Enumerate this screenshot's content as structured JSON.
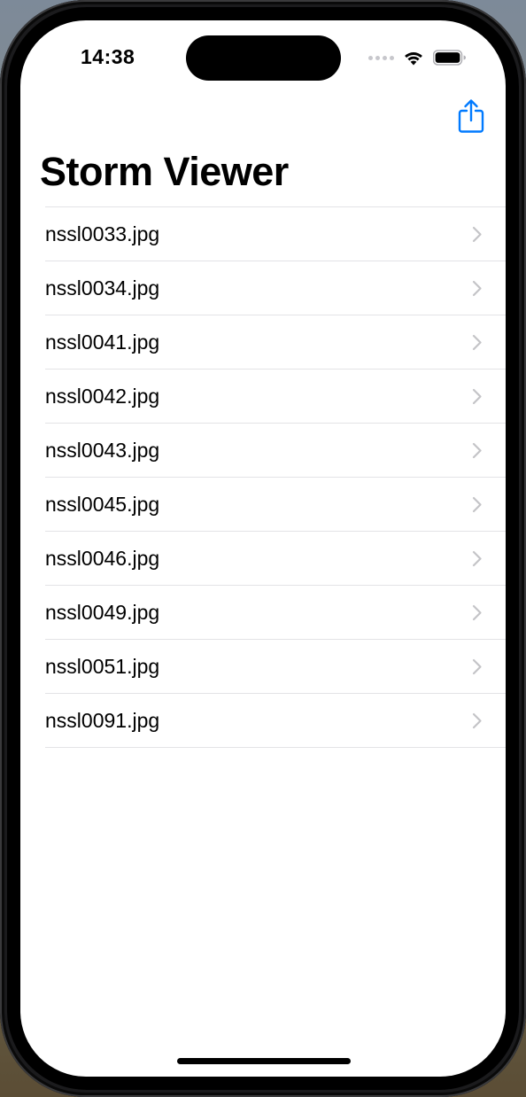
{
  "status_bar": {
    "time": "14:38",
    "wifi_icon": "wifi-icon",
    "battery_icon": "battery-icon"
  },
  "nav_bar": {
    "title": "Storm Viewer",
    "share_icon": "share-icon",
    "accent_color": "#007AFF"
  },
  "files": [
    {
      "label": "nssl0033.jpg"
    },
    {
      "label": "nssl0034.jpg"
    },
    {
      "label": "nssl0041.jpg"
    },
    {
      "label": "nssl0042.jpg"
    },
    {
      "label": "nssl0043.jpg"
    },
    {
      "label": "nssl0045.jpg"
    },
    {
      "label": "nssl0046.jpg"
    },
    {
      "label": "nssl0049.jpg"
    },
    {
      "label": "nssl0051.jpg"
    },
    {
      "label": "nssl0091.jpg"
    }
  ],
  "row_icon": "chevron-right-icon"
}
